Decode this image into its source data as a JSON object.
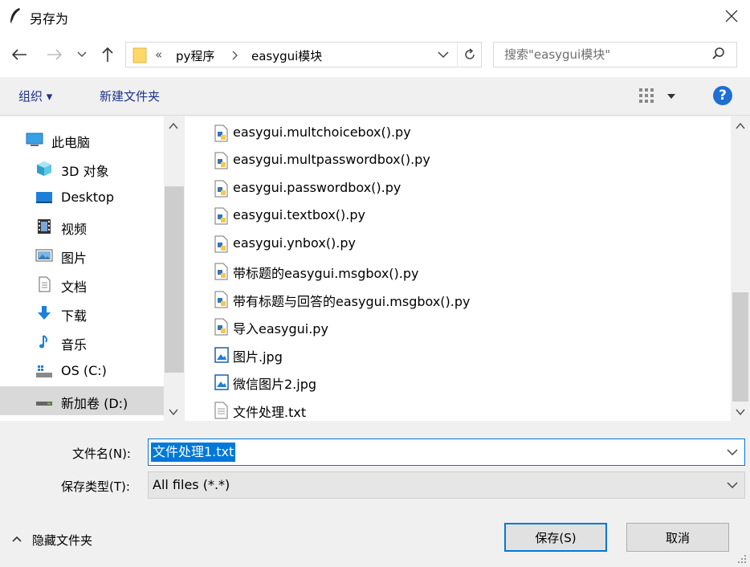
{
  "window": {
    "title": "另存为"
  },
  "nav": {
    "breadcrumb": [
      "«",
      "py程序",
      "easygui模块"
    ],
    "search_placeholder": "搜索\"easygui模块\""
  },
  "toolbar": {
    "organize_label": "组织 ▾",
    "new_folder_label": "新建文件夹"
  },
  "sidebar": {
    "items": [
      {
        "label": "此电脑",
        "icon": "computer-icon"
      },
      {
        "label": "3D 对象",
        "icon": "cube-icon"
      },
      {
        "label": "Desktop",
        "icon": "desktop-icon"
      },
      {
        "label": "视频",
        "icon": "video-icon"
      },
      {
        "label": "图片",
        "icon": "pictures-icon"
      },
      {
        "label": "文档",
        "icon": "document-icon"
      },
      {
        "label": "下载",
        "icon": "download-icon"
      },
      {
        "label": "音乐",
        "icon": "music-icon"
      },
      {
        "label": "OS (C:)",
        "icon": "drive-c-icon"
      },
      {
        "label": "新加卷 (D:)",
        "icon": "drive-d-icon",
        "selected": true
      }
    ]
  },
  "files": [
    {
      "name": "easygui.multchoicebox().py",
      "type": "python"
    },
    {
      "name": "easygui.multpasswordbox().py",
      "type": "python"
    },
    {
      "name": "easygui.passwordbox().py",
      "type": "python"
    },
    {
      "name": "easygui.textbox().py",
      "type": "python"
    },
    {
      "name": "easygui.ynbox().py",
      "type": "python"
    },
    {
      "name": "带标题的easygui.msgbox().py",
      "type": "python"
    },
    {
      "name": "带有标题与回答的easygui.msgbox().py",
      "type": "python"
    },
    {
      "name": "导入easygui.py",
      "type": "python"
    },
    {
      "name": "图片.jpg",
      "type": "image"
    },
    {
      "name": "微信图片2.jpg",
      "type": "image"
    },
    {
      "name": "文件处理.txt",
      "type": "text"
    }
  ],
  "form": {
    "filename_label": "文件名(N):",
    "filename_value": "文件处理1.txt",
    "filetype_label": "保存类型(T):",
    "filetype_value": "All files (*.*)"
  },
  "footer": {
    "hide_folders_label": "隐藏文件夹",
    "save_label": "保存(S)",
    "cancel_label": "取消"
  },
  "colors": {
    "accent": "#0078d7",
    "link": "#1e3287",
    "selected_row": "#d9d9d9"
  }
}
